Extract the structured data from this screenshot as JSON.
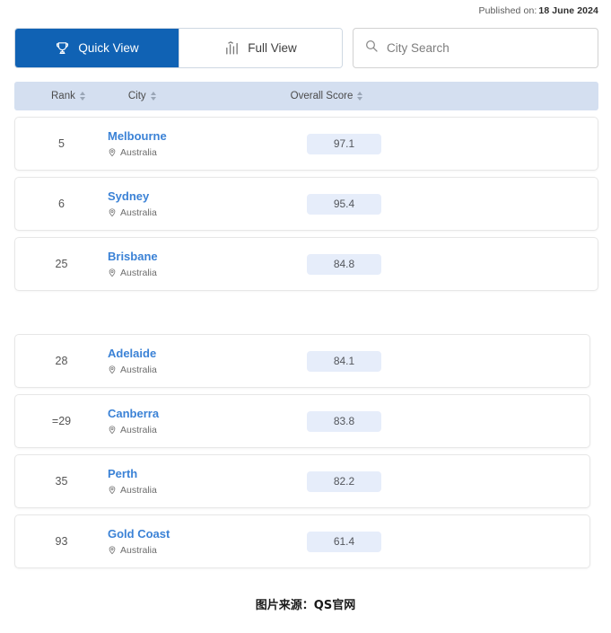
{
  "header": {
    "published_label": "Published on:",
    "published_date": "18 June 2024"
  },
  "tabs": [
    {
      "label": "Quick View",
      "icon": "trophy-icon",
      "active": true
    },
    {
      "label": "Full View",
      "icon": "bar-chart-icon",
      "active": false
    }
  ],
  "search": {
    "placeholder": "City Search",
    "value": "",
    "icon": "search-icon"
  },
  "table": {
    "columns": [
      {
        "label": "Rank",
        "sortable": true
      },
      {
        "label": "City",
        "sortable": true
      },
      {
        "label": "Overall Score",
        "sortable": true
      }
    ],
    "groups": [
      {
        "rows": [
          {
            "rank": "5",
            "city": "Melbourne",
            "country": "Australia",
            "score": "97.1"
          },
          {
            "rank": "6",
            "city": "Sydney",
            "country": "Australia",
            "score": "95.4"
          },
          {
            "rank": "25",
            "city": "Brisbane",
            "country": "Australia",
            "score": "84.8"
          }
        ]
      },
      {
        "rows": [
          {
            "rank": "28",
            "city": "Adelaide",
            "country": "Australia",
            "score": "84.1"
          },
          {
            "rank": "=29",
            "city": "Canberra",
            "country": "Australia",
            "score": "83.8"
          },
          {
            "rank": "35",
            "city": "Perth",
            "country": "Australia",
            "score": "82.2"
          },
          {
            "rank": "93",
            "city": "Gold Coast",
            "country": "Australia",
            "score": "61.4"
          }
        ]
      }
    ]
  },
  "caption": "图片来源：QS官网",
  "colors": {
    "accent_blue": "#1062b4",
    "link_blue": "#3b82d6",
    "header_band": "#d4dff0",
    "score_pill": "#e6edfa"
  }
}
